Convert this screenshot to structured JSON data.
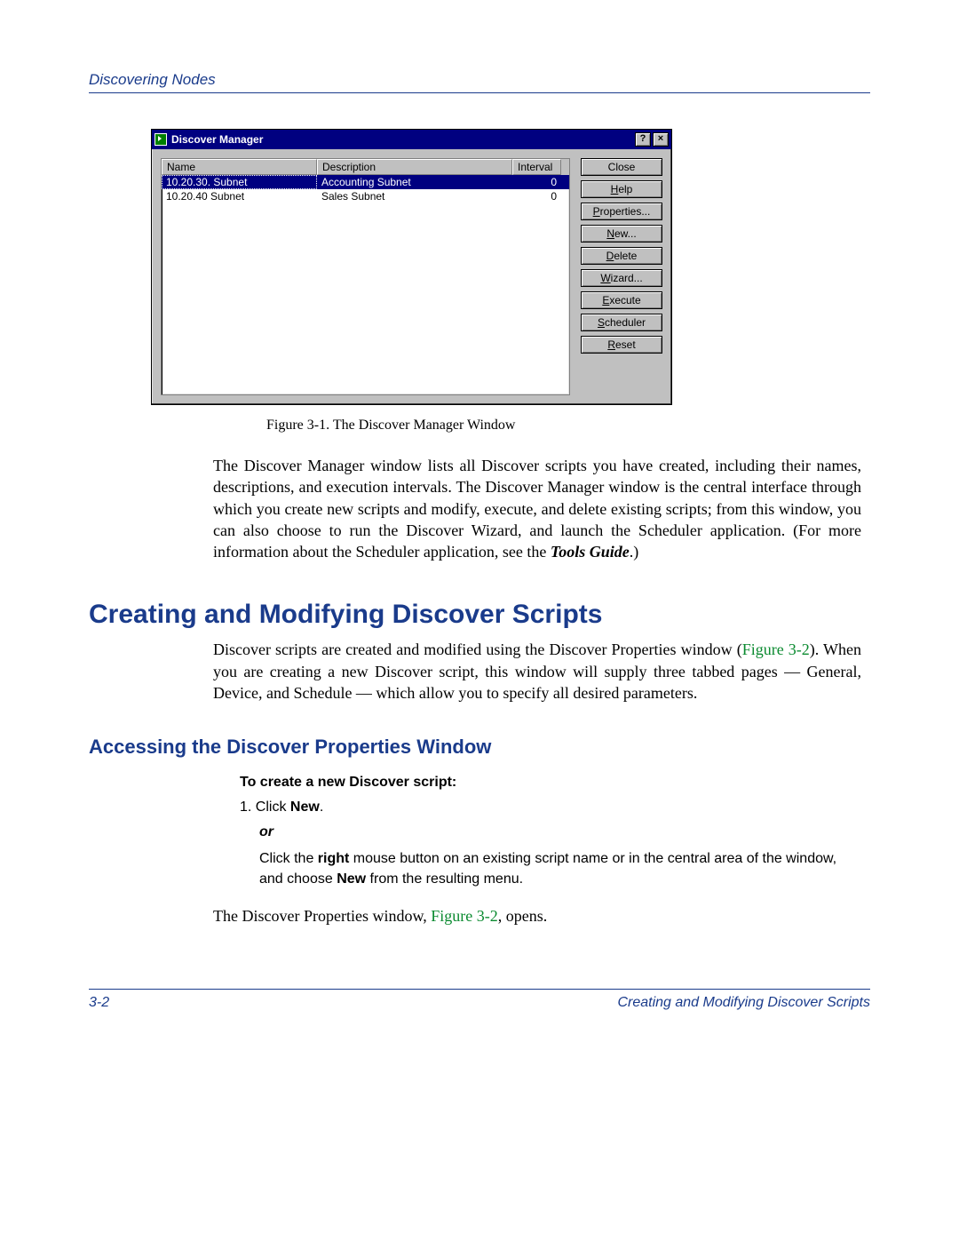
{
  "header": {
    "section_title": "Discovering Nodes"
  },
  "window": {
    "title": "Discover Manager",
    "help_glyph": "?",
    "close_glyph": "×",
    "columns": {
      "name": "Name",
      "description": "Description",
      "interval": "Interval"
    },
    "rows": [
      {
        "name": "10.20.30. Subnet",
        "description": "Accounting Subnet",
        "interval": "0",
        "selected": true
      },
      {
        "name": "10.20.40 Subnet",
        "description": "Sales Subnet",
        "interval": "0",
        "selected": false
      }
    ],
    "buttons": {
      "close": "Close",
      "help": "Help",
      "properties": "Properties...",
      "new": "New...",
      "delete": "Delete",
      "wizard": "Wizard...",
      "execute": "Execute",
      "scheduler": "Scheduler",
      "reset": "Reset"
    }
  },
  "figure1_caption": "Figure 3-1. The Discover Manager Window",
  "para1_a": "The Discover Manager window lists all Discover scripts you have created, including their names, descriptions, and execution intervals. The Discover Manager window is the central interface through which you create new scripts and modify, execute, and delete existing scripts; from this window, you can also choose to run the Discover Wizard, and launch the Scheduler application. (For more information about the Scheduler application, see the ",
  "para1_tools": "Tools Guide",
  "para1_b": ".)",
  "h1": "Creating and Modifying Discover Scripts",
  "para2_a": "Discover scripts are created and modified using the Discover Properties window (",
  "para2_ref": "Figure 3-2",
  "para2_b": "). When you are creating a new Discover script, this window will supply three tabbed pages — General, Device, and Schedule — which allow you to specify all desired parameters.",
  "h2": "Accessing the Discover Properties Window",
  "instr_heading": "To create a new Discover script:",
  "step1_a": "1.   Click ",
  "step1_bold": "New",
  "step1_b": ".",
  "step_or": "or",
  "step_alt_a": "Click the ",
  "step_alt_bold1": "right",
  "step_alt_b": " mouse button on an existing script name or in the central area of the window, and choose ",
  "step_alt_bold2": "New",
  "step_alt_c": " from the resulting menu.",
  "closing_a": "The Discover Properties window, ",
  "closing_ref": "Figure 3-2",
  "closing_b": ", opens.",
  "footer": {
    "page": "3-2",
    "title": "Creating and Modifying Discover Scripts"
  }
}
